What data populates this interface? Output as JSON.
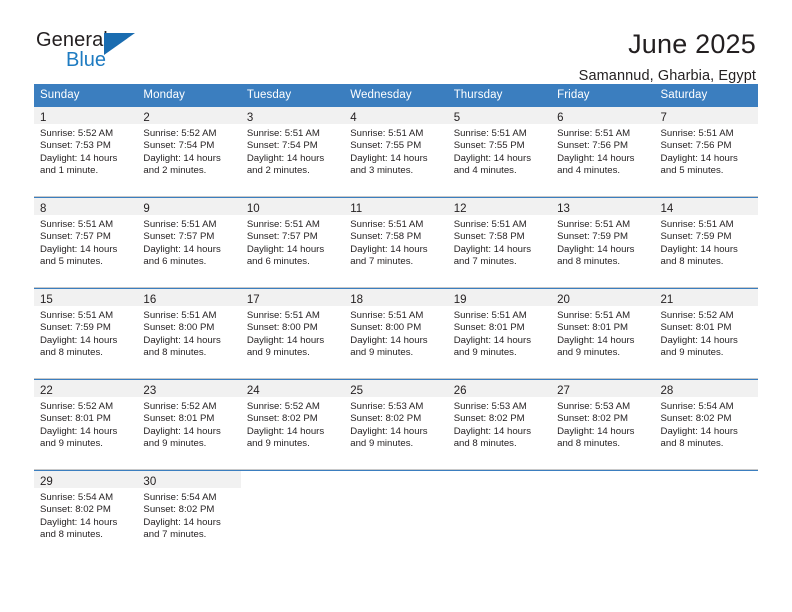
{
  "brand": {
    "name_top": "General",
    "name_bottom": "Blue",
    "triangle_color": "#1a6cb0",
    "blue_text_color": "#1e7bc1"
  },
  "header": {
    "title": "June 2025",
    "subtitle": "Samannud, Gharbia, Egypt"
  },
  "theme": {
    "header_row_bg": "#3b7ebf",
    "header_row_text": "#ffffff",
    "daynum_bg": "#f1f1f1",
    "cell_bg": "#ffffff",
    "grid_line": "#c9c9c9",
    "week_top_line": "#3b7ebf",
    "text": "#231f20"
  },
  "weekdays": [
    "Sunday",
    "Monday",
    "Tuesday",
    "Wednesday",
    "Thursday",
    "Friday",
    "Saturday"
  ],
  "labels": {
    "sunrise_prefix": "Sunrise:",
    "sunset_prefix": "Sunset:",
    "daylight_prefix": "Daylight:"
  },
  "weeks": [
    [
      {
        "day": "1",
        "sunrise": "Sunrise: 5:52 AM",
        "sunset": "Sunset: 7:53 PM",
        "daylight_line1": "Daylight: 14 hours",
        "daylight_line2": "and 1 minute."
      },
      {
        "day": "2",
        "sunrise": "Sunrise: 5:52 AM",
        "sunset": "Sunset: 7:54 PM",
        "daylight_line1": "Daylight: 14 hours",
        "daylight_line2": "and 2 minutes."
      },
      {
        "day": "3",
        "sunrise": "Sunrise: 5:51 AM",
        "sunset": "Sunset: 7:54 PM",
        "daylight_line1": "Daylight: 14 hours",
        "daylight_line2": "and 2 minutes."
      },
      {
        "day": "4",
        "sunrise": "Sunrise: 5:51 AM",
        "sunset": "Sunset: 7:55 PM",
        "daylight_line1": "Daylight: 14 hours",
        "daylight_line2": "and 3 minutes."
      },
      {
        "day": "5",
        "sunrise": "Sunrise: 5:51 AM",
        "sunset": "Sunset: 7:55 PM",
        "daylight_line1": "Daylight: 14 hours",
        "daylight_line2": "and 4 minutes."
      },
      {
        "day": "6",
        "sunrise": "Sunrise: 5:51 AM",
        "sunset": "Sunset: 7:56 PM",
        "daylight_line1": "Daylight: 14 hours",
        "daylight_line2": "and 4 minutes."
      },
      {
        "day": "7",
        "sunrise": "Sunrise: 5:51 AM",
        "sunset": "Sunset: 7:56 PM",
        "daylight_line1": "Daylight: 14 hours",
        "daylight_line2": "and 5 minutes."
      }
    ],
    [
      {
        "day": "8",
        "sunrise": "Sunrise: 5:51 AM",
        "sunset": "Sunset: 7:57 PM",
        "daylight_line1": "Daylight: 14 hours",
        "daylight_line2": "and 5 minutes."
      },
      {
        "day": "9",
        "sunrise": "Sunrise: 5:51 AM",
        "sunset": "Sunset: 7:57 PM",
        "daylight_line1": "Daylight: 14 hours",
        "daylight_line2": "and 6 minutes."
      },
      {
        "day": "10",
        "sunrise": "Sunrise: 5:51 AM",
        "sunset": "Sunset: 7:57 PM",
        "daylight_line1": "Daylight: 14 hours",
        "daylight_line2": "and 6 minutes."
      },
      {
        "day": "11",
        "sunrise": "Sunrise: 5:51 AM",
        "sunset": "Sunset: 7:58 PM",
        "daylight_line1": "Daylight: 14 hours",
        "daylight_line2": "and 7 minutes."
      },
      {
        "day": "12",
        "sunrise": "Sunrise: 5:51 AM",
        "sunset": "Sunset: 7:58 PM",
        "daylight_line1": "Daylight: 14 hours",
        "daylight_line2": "and 7 minutes."
      },
      {
        "day": "13",
        "sunrise": "Sunrise: 5:51 AM",
        "sunset": "Sunset: 7:59 PM",
        "daylight_line1": "Daylight: 14 hours",
        "daylight_line2": "and 8 minutes."
      },
      {
        "day": "14",
        "sunrise": "Sunrise: 5:51 AM",
        "sunset": "Sunset: 7:59 PM",
        "daylight_line1": "Daylight: 14 hours",
        "daylight_line2": "and 8 minutes."
      }
    ],
    [
      {
        "day": "15",
        "sunrise": "Sunrise: 5:51 AM",
        "sunset": "Sunset: 7:59 PM",
        "daylight_line1": "Daylight: 14 hours",
        "daylight_line2": "and 8 minutes."
      },
      {
        "day": "16",
        "sunrise": "Sunrise: 5:51 AM",
        "sunset": "Sunset: 8:00 PM",
        "daylight_line1": "Daylight: 14 hours",
        "daylight_line2": "and 8 minutes."
      },
      {
        "day": "17",
        "sunrise": "Sunrise: 5:51 AM",
        "sunset": "Sunset: 8:00 PM",
        "daylight_line1": "Daylight: 14 hours",
        "daylight_line2": "and 9 minutes."
      },
      {
        "day": "18",
        "sunrise": "Sunrise: 5:51 AM",
        "sunset": "Sunset: 8:00 PM",
        "daylight_line1": "Daylight: 14 hours",
        "daylight_line2": "and 9 minutes."
      },
      {
        "day": "19",
        "sunrise": "Sunrise: 5:51 AM",
        "sunset": "Sunset: 8:01 PM",
        "daylight_line1": "Daylight: 14 hours",
        "daylight_line2": "and 9 minutes."
      },
      {
        "day": "20",
        "sunrise": "Sunrise: 5:51 AM",
        "sunset": "Sunset: 8:01 PM",
        "daylight_line1": "Daylight: 14 hours",
        "daylight_line2": "and 9 minutes."
      },
      {
        "day": "21",
        "sunrise": "Sunrise: 5:52 AM",
        "sunset": "Sunset: 8:01 PM",
        "daylight_line1": "Daylight: 14 hours",
        "daylight_line2": "and 9 minutes."
      }
    ],
    [
      {
        "day": "22",
        "sunrise": "Sunrise: 5:52 AM",
        "sunset": "Sunset: 8:01 PM",
        "daylight_line1": "Daylight: 14 hours",
        "daylight_line2": "and 9 minutes."
      },
      {
        "day": "23",
        "sunrise": "Sunrise: 5:52 AM",
        "sunset": "Sunset: 8:01 PM",
        "daylight_line1": "Daylight: 14 hours",
        "daylight_line2": "and 9 minutes."
      },
      {
        "day": "24",
        "sunrise": "Sunrise: 5:52 AM",
        "sunset": "Sunset: 8:02 PM",
        "daylight_line1": "Daylight: 14 hours",
        "daylight_line2": "and 9 minutes."
      },
      {
        "day": "25",
        "sunrise": "Sunrise: 5:53 AM",
        "sunset": "Sunset: 8:02 PM",
        "daylight_line1": "Daylight: 14 hours",
        "daylight_line2": "and 9 minutes."
      },
      {
        "day": "26",
        "sunrise": "Sunrise: 5:53 AM",
        "sunset": "Sunset: 8:02 PM",
        "daylight_line1": "Daylight: 14 hours",
        "daylight_line2": "and 8 minutes."
      },
      {
        "day": "27",
        "sunrise": "Sunrise: 5:53 AM",
        "sunset": "Sunset: 8:02 PM",
        "daylight_line1": "Daylight: 14 hours",
        "daylight_line2": "and 8 minutes."
      },
      {
        "day": "28",
        "sunrise": "Sunrise: 5:54 AM",
        "sunset": "Sunset: 8:02 PM",
        "daylight_line1": "Daylight: 14 hours",
        "daylight_line2": "and 8 minutes."
      }
    ],
    [
      {
        "day": "29",
        "sunrise": "Sunrise: 5:54 AM",
        "sunset": "Sunset: 8:02 PM",
        "daylight_line1": "Daylight: 14 hours",
        "daylight_line2": "and 8 minutes."
      },
      {
        "day": "30",
        "sunrise": "Sunrise: 5:54 AM",
        "sunset": "Sunset: 8:02 PM",
        "daylight_line1": "Daylight: 14 hours",
        "daylight_line2": "and 7 minutes."
      },
      {
        "day": "",
        "sunrise": "",
        "sunset": "",
        "daylight_line1": "",
        "daylight_line2": ""
      },
      {
        "day": "",
        "sunrise": "",
        "sunset": "",
        "daylight_line1": "",
        "daylight_line2": ""
      },
      {
        "day": "",
        "sunrise": "",
        "sunset": "",
        "daylight_line1": "",
        "daylight_line2": ""
      },
      {
        "day": "",
        "sunrise": "",
        "sunset": "",
        "daylight_line1": "",
        "daylight_line2": ""
      },
      {
        "day": "",
        "sunrise": "",
        "sunset": "",
        "daylight_line1": "",
        "daylight_line2": ""
      }
    ]
  ]
}
